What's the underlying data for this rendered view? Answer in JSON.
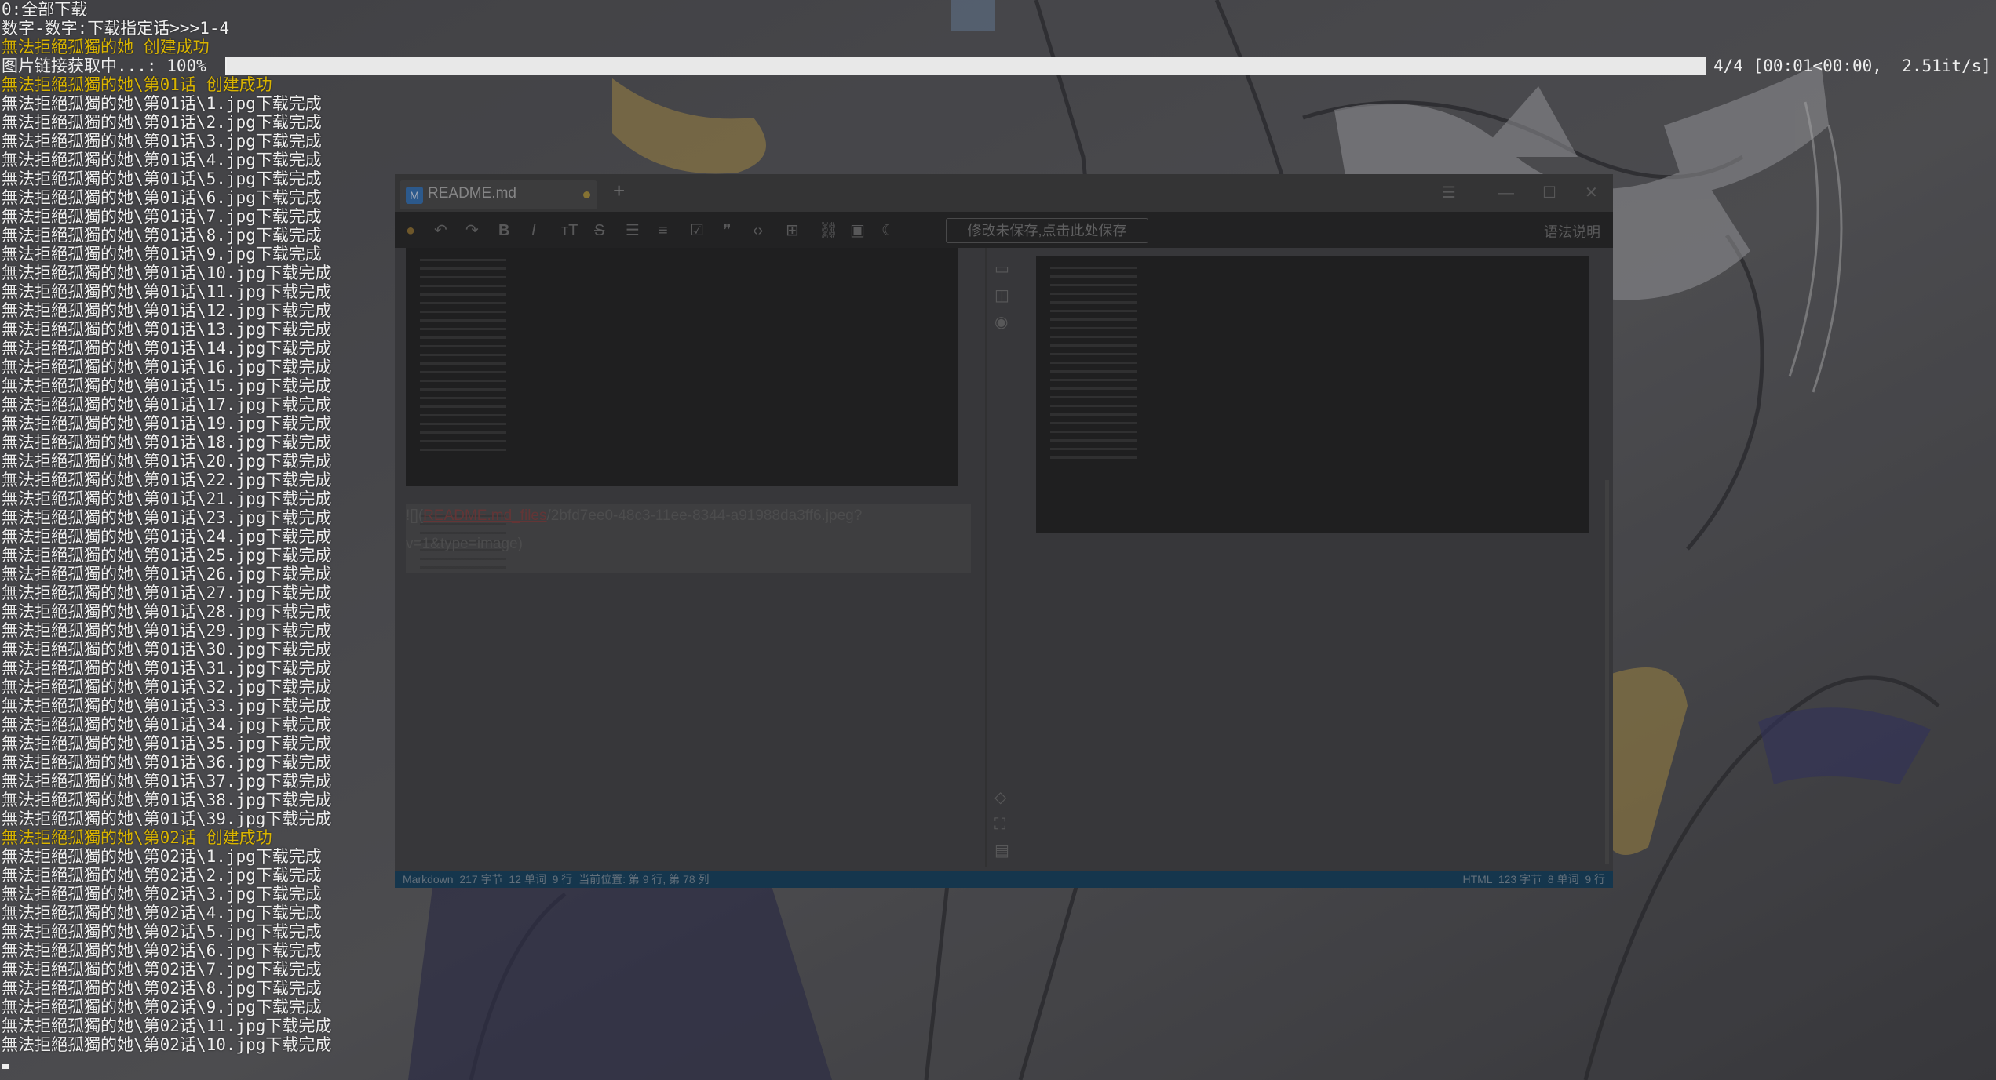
{
  "terminal": {
    "lines": [
      {
        "text": "0:全部下载",
        "color": "white"
      },
      {
        "text": "数字-数字:下载指定话>>>1-4",
        "color": "white"
      },
      {
        "text": "無法拒絕孤獨的她 创建成功",
        "color": "yellow"
      },
      {
        "text": "",
        "color": "white"
      },
      {
        "text": "無法拒絕孤獨的她\\第01话 创建成功",
        "color": "yellow"
      },
      {
        "text": "無法拒絕孤獨的她\\第01话\\1.jpg下载完成",
        "color": "white"
      },
      {
        "text": "無法拒絕孤獨的她\\第01话\\2.jpg下载完成",
        "color": "white"
      },
      {
        "text": "無法拒絕孤獨的她\\第01话\\3.jpg下载完成",
        "color": "white"
      },
      {
        "text": "無法拒絕孤獨的她\\第01话\\4.jpg下载完成",
        "color": "white"
      },
      {
        "text": "無法拒絕孤獨的她\\第01话\\5.jpg下载完成",
        "color": "white"
      },
      {
        "text": "無法拒絕孤獨的她\\第01话\\6.jpg下载完成",
        "color": "white"
      },
      {
        "text": "無法拒絕孤獨的她\\第01话\\7.jpg下载完成",
        "color": "white"
      },
      {
        "text": "無法拒絕孤獨的她\\第01话\\8.jpg下载完成",
        "color": "white"
      },
      {
        "text": "無法拒絕孤獨的她\\第01话\\9.jpg下载完成",
        "color": "white"
      },
      {
        "text": "無法拒絕孤獨的她\\第01话\\10.jpg下载完成",
        "color": "white"
      },
      {
        "text": "無法拒絕孤獨的她\\第01话\\11.jpg下载完成",
        "color": "white"
      },
      {
        "text": "無法拒絕孤獨的她\\第01话\\12.jpg下载完成",
        "color": "white"
      },
      {
        "text": "無法拒絕孤獨的她\\第01话\\13.jpg下载完成",
        "color": "white"
      },
      {
        "text": "無法拒絕孤獨的她\\第01话\\14.jpg下载完成",
        "color": "white"
      },
      {
        "text": "無法拒絕孤獨的她\\第01话\\16.jpg下载完成",
        "color": "white"
      },
      {
        "text": "無法拒絕孤獨的她\\第01话\\15.jpg下载完成",
        "color": "white"
      },
      {
        "text": "無法拒絕孤獨的她\\第01话\\17.jpg下载完成",
        "color": "white"
      },
      {
        "text": "無法拒絕孤獨的她\\第01话\\19.jpg下载完成",
        "color": "white"
      },
      {
        "text": "無法拒絕孤獨的她\\第01话\\18.jpg下载完成",
        "color": "white"
      },
      {
        "text": "無法拒絕孤獨的她\\第01话\\20.jpg下载完成",
        "color": "white"
      },
      {
        "text": "無法拒絕孤獨的她\\第01话\\22.jpg下载完成",
        "color": "white"
      },
      {
        "text": "無法拒絕孤獨的她\\第01话\\21.jpg下载完成",
        "color": "white"
      },
      {
        "text": "無法拒絕孤獨的她\\第01话\\23.jpg下载完成",
        "color": "white"
      },
      {
        "text": "無法拒絕孤獨的她\\第01话\\24.jpg下载完成",
        "color": "white"
      },
      {
        "text": "無法拒絕孤獨的她\\第01话\\25.jpg下载完成",
        "color": "white"
      },
      {
        "text": "無法拒絕孤獨的她\\第01话\\26.jpg下载完成",
        "color": "white"
      },
      {
        "text": "無法拒絕孤獨的她\\第01话\\27.jpg下载完成",
        "color": "white"
      },
      {
        "text": "無法拒絕孤獨的她\\第01话\\28.jpg下载完成",
        "color": "white"
      },
      {
        "text": "無法拒絕孤獨的她\\第01话\\29.jpg下载完成",
        "color": "white"
      },
      {
        "text": "無法拒絕孤獨的她\\第01话\\30.jpg下载完成",
        "color": "white"
      },
      {
        "text": "無法拒絕孤獨的她\\第01话\\31.jpg下载完成",
        "color": "white"
      },
      {
        "text": "無法拒絕孤獨的她\\第01话\\32.jpg下载完成",
        "color": "white"
      },
      {
        "text": "無法拒絕孤獨的她\\第01话\\33.jpg下载完成",
        "color": "white"
      },
      {
        "text": "無法拒絕孤獨的她\\第01话\\34.jpg下载完成",
        "color": "white"
      },
      {
        "text": "無法拒絕孤獨的她\\第01话\\35.jpg下载完成",
        "color": "white"
      },
      {
        "text": "無法拒絕孤獨的她\\第01话\\36.jpg下载完成",
        "color": "white"
      },
      {
        "text": "無法拒絕孤獨的她\\第01话\\37.jpg下载完成",
        "color": "white"
      },
      {
        "text": "無法拒絕孤獨的她\\第01话\\38.jpg下载完成",
        "color": "white"
      },
      {
        "text": "無法拒絕孤獨的她\\第01话\\39.jpg下载完成",
        "color": "white"
      },
      {
        "text": "無法拒絕孤獨的她\\第02话 创建成功",
        "color": "yellow"
      },
      {
        "text": "無法拒絕孤獨的她\\第02话\\1.jpg下载完成",
        "color": "white"
      },
      {
        "text": "無法拒絕孤獨的她\\第02话\\2.jpg下载完成",
        "color": "white"
      },
      {
        "text": "無法拒絕孤獨的她\\第02话\\3.jpg下载完成",
        "color": "white"
      },
      {
        "text": "無法拒絕孤獨的她\\第02话\\4.jpg下载完成",
        "color": "white"
      },
      {
        "text": "無法拒絕孤獨的她\\第02话\\5.jpg下载完成",
        "color": "white"
      },
      {
        "text": "無法拒絕孤獨的她\\第02话\\6.jpg下载完成",
        "color": "white"
      },
      {
        "text": "無法拒絕孤獨的她\\第02话\\7.jpg下载完成",
        "color": "white"
      },
      {
        "text": "無法拒絕孤獨的她\\第02话\\8.jpg下载完成",
        "color": "white"
      },
      {
        "text": "無法拒絕孤獨的她\\第02话\\9.jpg下载完成",
        "color": "white"
      },
      {
        "text": "無法拒絕孤獨的她\\第02话\\11.jpg下载完成",
        "color": "white"
      },
      {
        "text": "無法拒絕孤獨的她\\第02话\\10.jpg下载完成",
        "color": "white"
      }
    ],
    "progress": {
      "label": "图片链接获取中...: 100%",
      "fraction": 1.0,
      "stats": "4/4 [00:01<00:00,  2.51it/s]"
    },
    "colors": {
      "text": "#eeeeee",
      "highlight": "#d9b400"
    }
  },
  "editor": {
    "tab_title": "README.md",
    "new_tab_label": "+",
    "save_hint": "修改未保存,点击此处保存",
    "syntax_help": "语法说明",
    "markdown_image_link": {
      "prefix": "![](",
      "link_text": "README.md_files",
      "suffix": "/2bfd7ee0-48c3-11ee-8344-a91988da3ff6.jpeg?v=1&type=image)"
    },
    "status_left": "Markdown  217 字节  12 单词  9 行  当前位置: 第 9 行, 第 78 列",
    "status_right": "HTML  123 字节  8 单词  9 行",
    "toolbar_icons": [
      "logo-icon",
      "undo-icon",
      "redo-icon",
      "bold-icon",
      "italic-icon",
      "heading-icon",
      "strikethrough-icon",
      "unordered-list-icon",
      "ordered-list-icon",
      "task-list-icon",
      "quote-icon",
      "code-icon",
      "table-icon",
      "link-icon",
      "image-icon",
      "dark-mode-icon"
    ],
    "colors": {
      "statusbar": "#0e3c5b",
      "toolbar": "#202020"
    }
  }
}
